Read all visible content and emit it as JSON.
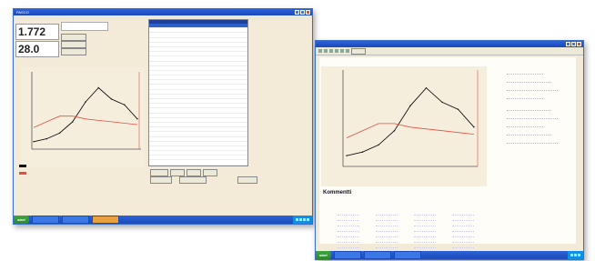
{
  "window1": {
    "title": "PASCO",
    "readout_top": "1.772",
    "readout_bottom": "28.0",
    "menu": [
      "",
      "",
      ""
    ],
    "side_buttons": [
      "",
      "",
      ""
    ],
    "legend_black_label": "",
    "legend_red_label": "",
    "bottom_buttons": [
      "",
      "",
      ""
    ],
    "x_ticks": [
      "",
      "",
      "",
      ""
    ]
  },
  "window2": {
    "title": "",
    "comments_heading": "Kommentti",
    "right_lines": [
      "",
      "",
      "",
      "",
      "",
      "",
      "",
      "",
      ""
    ],
    "x_ticks": [
      "",
      "",
      "",
      ""
    ]
  },
  "taskbar": {
    "start": "start",
    "tasks1": [
      "",
      "",
      ""
    ],
    "tasks2": [
      "",
      "",
      ""
    ]
  },
  "colors": {
    "black_series": "#111111",
    "red_series": "#e05040",
    "titlebar": "#2b62d9"
  },
  "chart_data": [
    {
      "type": "line",
      "series": [
        {
          "values": [
            0.2,
            0.3,
            0.5,
            0.9,
            1.6,
            2.1,
            1.7,
            1.5,
            1.0
          ]
        },
        {
          "values": [
            0.7,
            0.9,
            1.1,
            1.1,
            1.0,
            0.95,
            0.9,
            0.85,
            0.8
          ]
        }
      ],
      "ylim": [
        0,
        2.5
      ]
    }
  ]
}
